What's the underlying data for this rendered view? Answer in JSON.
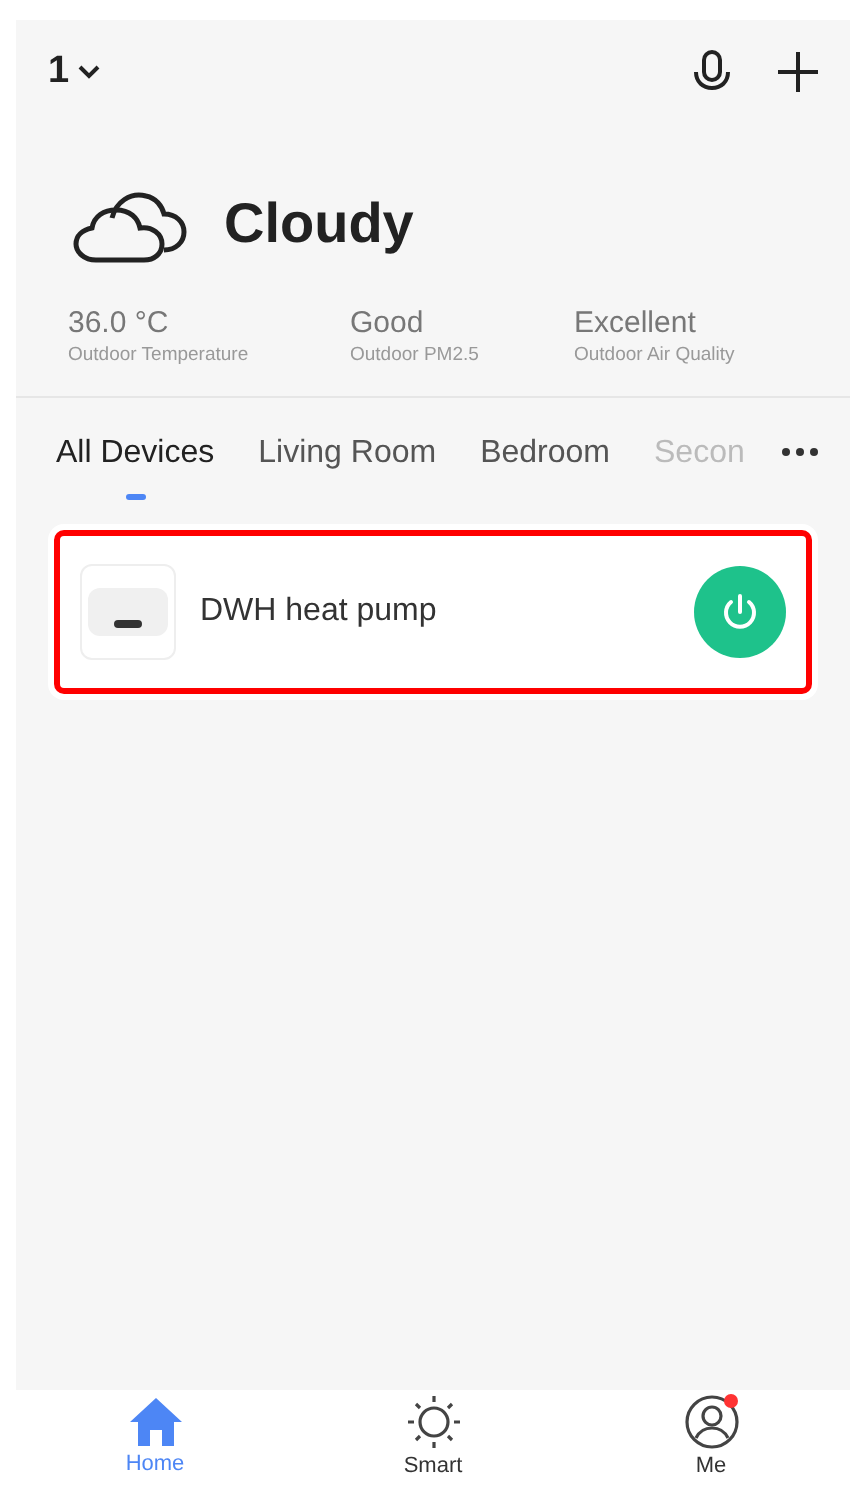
{
  "header": {
    "home": "1"
  },
  "weather": {
    "condition": "Cloudy",
    "stats": [
      {
        "value": "36.0 °C",
        "label": "Outdoor Temperature"
      },
      {
        "value": "Good",
        "label": "Outdoor PM2.5"
      },
      {
        "value": "Excellent",
        "label": "Outdoor Air Quality"
      }
    ]
  },
  "tabs": [
    {
      "label": "All Devices",
      "selected": true
    },
    {
      "label": "Living Room",
      "selected": false
    },
    {
      "label": "Bedroom",
      "selected": false
    },
    {
      "label": "Secon",
      "selected": false
    }
  ],
  "devices": [
    {
      "name": "DWH heat pump",
      "on": true,
      "highlighted": true
    }
  ],
  "nav": [
    {
      "kind": "home",
      "label": "Home",
      "selected": true,
      "badge": false
    },
    {
      "kind": "smart",
      "label": "Smart",
      "selected": false,
      "badge": false
    },
    {
      "kind": "me",
      "label": "Me",
      "selected": false,
      "badge": true
    }
  ]
}
